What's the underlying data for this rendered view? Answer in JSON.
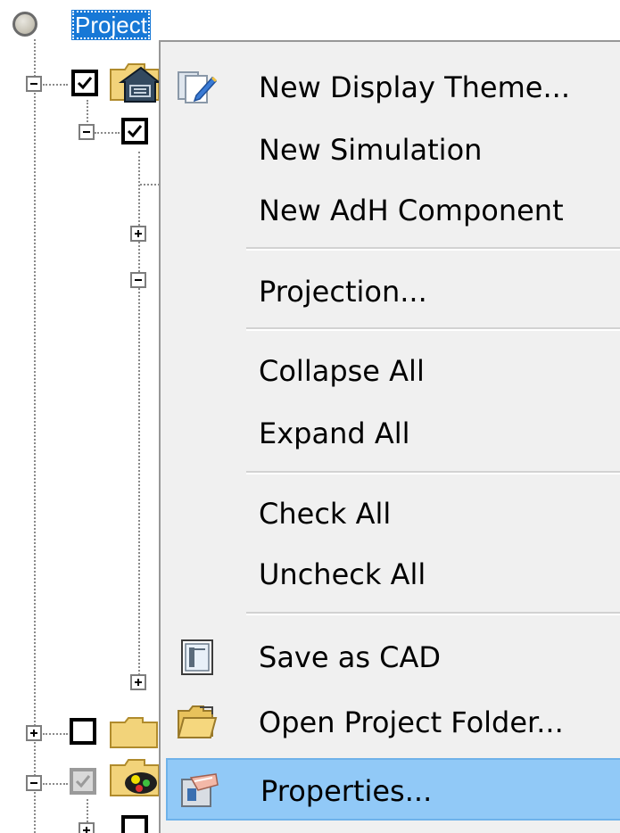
{
  "tree": {
    "root_label": "Project"
  },
  "menu": {
    "items": [
      {
        "label": "New Display Theme...",
        "icon": "display-theme-icon"
      },
      {
        "label": "New Simulation",
        "icon": ""
      },
      {
        "label": "New AdH Component",
        "icon": ""
      },
      {
        "label": "Projection...",
        "icon": ""
      },
      {
        "label": "Collapse All",
        "icon": ""
      },
      {
        "label": "Expand All",
        "icon": ""
      },
      {
        "label": "Check All",
        "icon": ""
      },
      {
        "label": "Uncheck All",
        "icon": ""
      },
      {
        "label": "Save as CAD",
        "icon": "cad-file-icon"
      },
      {
        "label": "Open Project Folder...",
        "icon": "open-folder-icon"
      },
      {
        "label": "Properties...",
        "icon": "properties-icon"
      }
    ],
    "hovered_item": "Properties..."
  },
  "colors": {
    "selection_blue": "#1778d6",
    "menu_background": "#f0f0f0",
    "menu_hover": "#91c9f7"
  }
}
